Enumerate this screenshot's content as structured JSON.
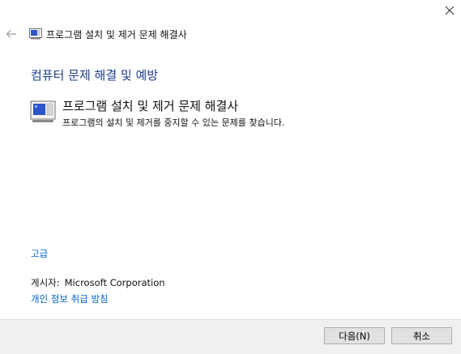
{
  "window": {
    "title": "프로그램 설치 및 제거 문제 해결사"
  },
  "nav": {
    "back_icon": "back-arrow-icon",
    "close_icon": "close-icon"
  },
  "main": {
    "section_heading": "컴퓨터 문제 해결 및 예방",
    "item": {
      "icon": "program-installer-icon",
      "title": "프로그램 설치 및 제거 문제 해결사",
      "description": "프로그램의 설치 및 제거를 중지할 수 있는 문제를 찾습니다."
    },
    "advanced_link": "고급",
    "publisher_label": "게시자:",
    "publisher_value": "Microsoft Corporation",
    "privacy_link": "개인 정보 취급 방침"
  },
  "footer": {
    "next_label": "다음(N)",
    "cancel_label": "취소"
  },
  "colors": {
    "heading": "#1e3c8c",
    "link": "#0066cc",
    "footer_bg": "#f0f0f0"
  }
}
